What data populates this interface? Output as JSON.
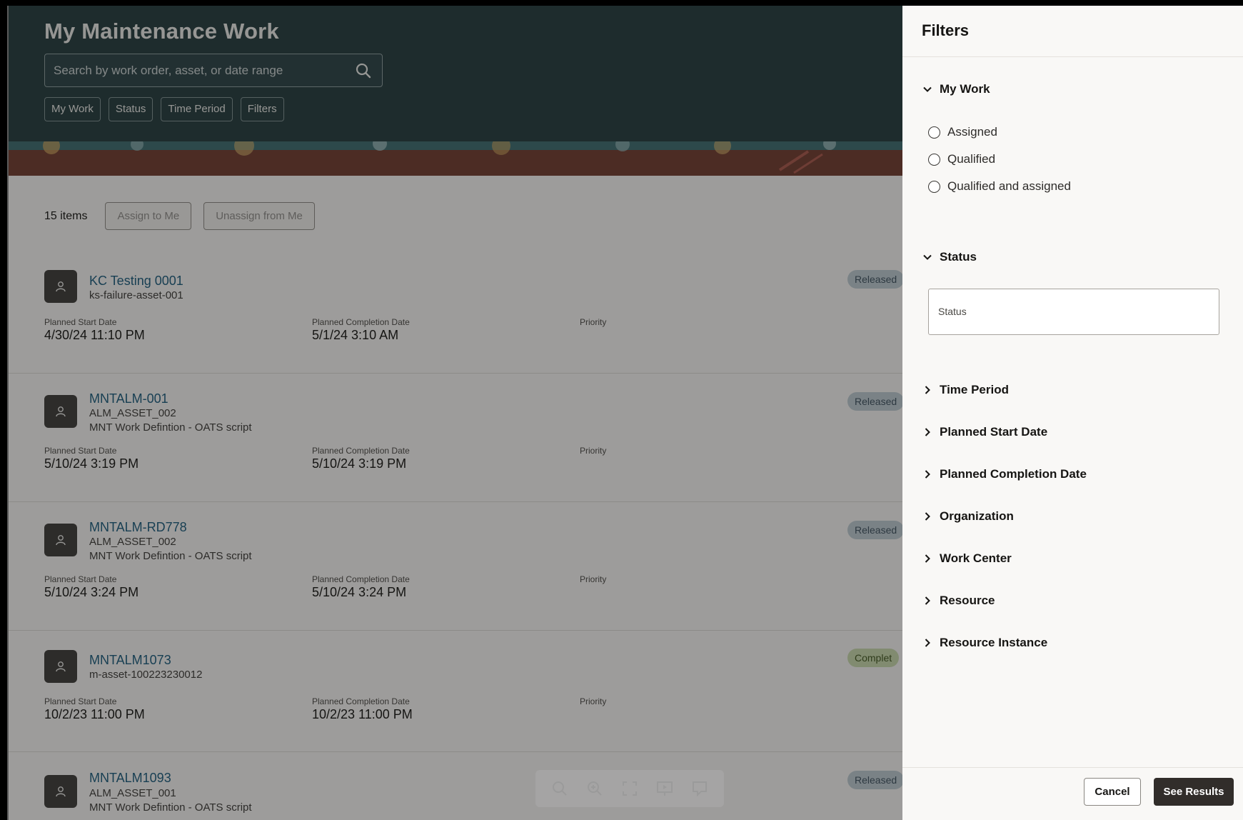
{
  "header": {
    "title": "My Maintenance Work",
    "search_placeholder": "Search by work order, asset, or date range",
    "chips": [
      "My Work",
      "Status",
      "Time Period",
      "Filters"
    ]
  },
  "toolbar": {
    "items_count": "15 items",
    "assign_label": "Assign to Me",
    "unassign_label": "Unassign from Me"
  },
  "labels": {
    "planned_start": "Planned Start Date",
    "planned_completion": "Planned Completion Date",
    "priority": "Priority"
  },
  "work_orders": [
    {
      "title": "KC Testing 0001",
      "asset": "ks-failure-asset-001",
      "description": "",
      "start": "4/30/24 11:10 PM",
      "completion": "5/1/24 3:10 AM",
      "status": "Released"
    },
    {
      "title": "MNTALM-001",
      "asset": "ALM_ASSET_002",
      "description": "MNT Work Defintion - OATS script",
      "start": "5/10/24 3:19 PM",
      "completion": "5/10/24 3:19 PM",
      "status": "Released"
    },
    {
      "title": "MNTALM-RD778",
      "asset": "ALM_ASSET_002",
      "description": "MNT Work Defintion - OATS script",
      "start": "5/10/24 3:24 PM",
      "completion": "5/10/24 3:24 PM",
      "status": "Released"
    },
    {
      "title": "MNTALM1073",
      "asset": "m-asset-100223230012",
      "description": "",
      "start": "10/2/23 11:00 PM",
      "completion": "10/2/23 11:00 PM",
      "status": "Complet"
    },
    {
      "title": "MNTALM1093",
      "asset": "ALM_ASSET_001",
      "description": "MNT Work Defintion - OATS script",
      "start": "",
      "completion": "",
      "status": "Released"
    }
  ],
  "filters": {
    "title": "Filters",
    "my_work": {
      "label": "My Work",
      "options": [
        "Assigned",
        "Qualified",
        "Qualified and assigned"
      ]
    },
    "status": {
      "label": "Status",
      "field_label": "Status"
    },
    "collapsed_sections": [
      "Time Period",
      "Planned Start Date",
      "Planned Completion Date",
      "Organization",
      "Work Center",
      "Resource",
      "Resource Instance"
    ],
    "cancel_label": "Cancel",
    "see_results_label": "See Results"
  },
  "colors": {
    "header_bg": "#243a3c",
    "link": "#1b5a7a",
    "primary_button": "#312d2a",
    "badge_released": "#b8c5cc",
    "badge_completed": "#c4d3a8"
  }
}
